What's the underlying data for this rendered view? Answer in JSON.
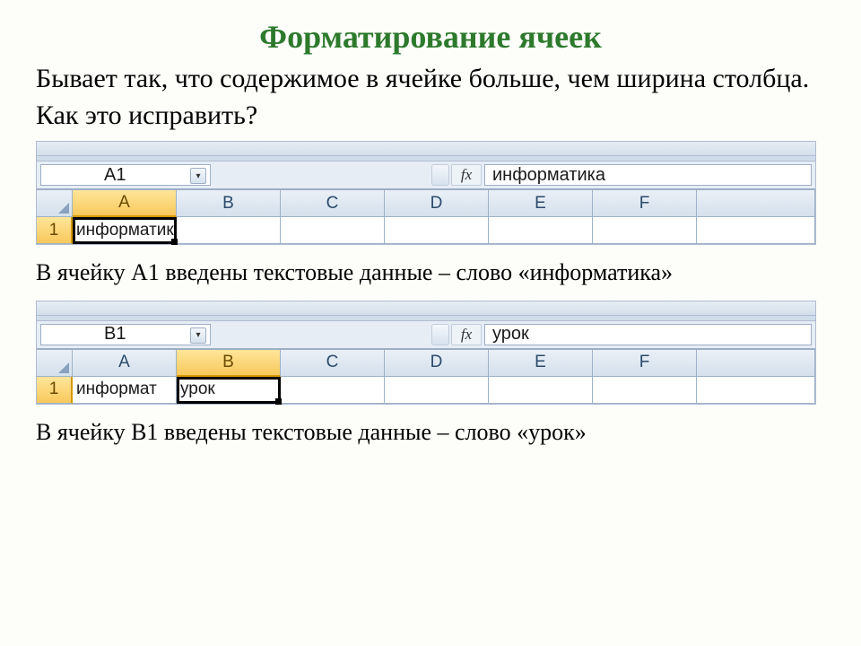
{
  "title": "Форматирование ячеек",
  "intro": "Бывает так, что содержимое в ячейке больше, чем ширина столбца. Как это исправить?",
  "caption1": "В ячейку А1 введены текстовые данные – слово «информатика»",
  "caption2": "В ячейку В1 введены текстовые данные – слово «урок»",
  "columns": [
    "A",
    "B",
    "C",
    "D",
    "E",
    "F"
  ],
  "row_label": "1",
  "fx_symbol": "fx",
  "shot1": {
    "namebox": "A1",
    "formula": "информатика",
    "active_col": "A",
    "a1_text": "информатика",
    "b1_text": ""
  },
  "shot2": {
    "namebox": "B1",
    "formula": "урок",
    "active_col": "B",
    "a1_text": "информат",
    "b1_text": "урок"
  }
}
